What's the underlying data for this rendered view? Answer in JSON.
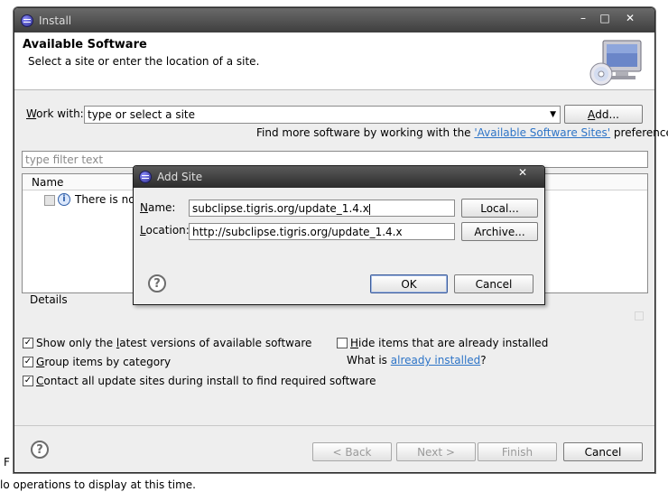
{
  "install": {
    "title": "Install",
    "header": {
      "title": "Available Software",
      "subtitle": "Select a site or enter the location of a site."
    },
    "work_with": {
      "label_prefix": "W",
      "label_rest": "ork with:",
      "placeholder": "type or select a site",
      "add_button_prefix": "A",
      "add_button_rest": "dd..."
    },
    "find_more": {
      "prefix": "Find more software by working with the ",
      "link": "'Available Software Sites'",
      "suffix": " preferences."
    },
    "filter_placeholder": "type filter text",
    "table": {
      "column_name": "Name",
      "row_text": "There is no"
    },
    "details_label": "Details",
    "options": {
      "show_latest_pre": "Show only the ",
      "show_latest_ul": "l",
      "show_latest_post": "atest versions of available software",
      "group_by_ul": "G",
      "group_by_post": "roup items by category",
      "contact_ul": "C",
      "contact_post": "ontact all update sites during install to find required software",
      "hide_installed_ul": "H",
      "hide_installed_post": "ide items that are already installed",
      "what_is_pre": "What is ",
      "what_is_link": "already installed",
      "what_is_post": "?"
    },
    "footer": {
      "back": "< Back",
      "next": "Next >",
      "finish": "Finish",
      "cancel": "Cancel"
    }
  },
  "add_site": {
    "title": "Add Site",
    "name_label_ul": "N",
    "name_label_rest": "ame:",
    "name_value": "subclipse.tigris.org/update_1.4.x",
    "location_label_ul": "L",
    "location_label_rest": "ocation:",
    "location_value": "http://subclipse.tigris.org/update_1.4.x",
    "local_button": "Local...",
    "archive_button": "Archive...",
    "ok_button": "OK",
    "cancel_button": "Cancel"
  },
  "background": {
    "status_text": "lo operations to display at this time.",
    "side_letter": "F"
  }
}
